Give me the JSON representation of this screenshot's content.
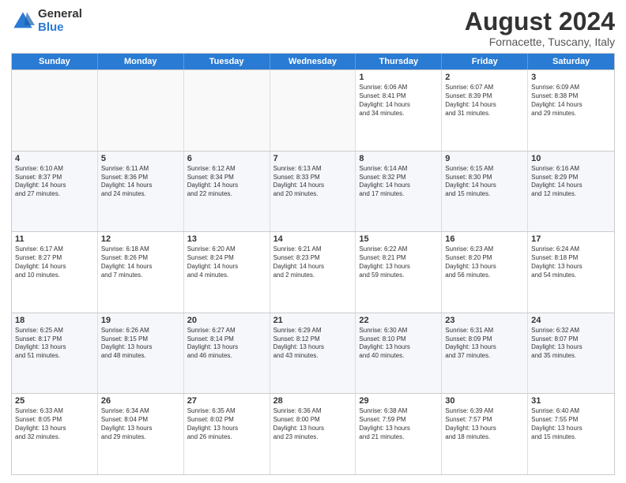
{
  "header": {
    "logo_general": "General",
    "logo_blue": "Blue",
    "title": "August 2024",
    "subtitle": "Fornacette, Tuscany, Italy"
  },
  "days_of_week": [
    "Sunday",
    "Monday",
    "Tuesday",
    "Wednesday",
    "Thursday",
    "Friday",
    "Saturday"
  ],
  "weeks": [
    [
      {
        "day": "",
        "info": ""
      },
      {
        "day": "",
        "info": ""
      },
      {
        "day": "",
        "info": ""
      },
      {
        "day": "",
        "info": ""
      },
      {
        "day": "1",
        "info": "Sunrise: 6:06 AM\nSunset: 8:41 PM\nDaylight: 14 hours\nand 34 minutes."
      },
      {
        "day": "2",
        "info": "Sunrise: 6:07 AM\nSunset: 8:39 PM\nDaylight: 14 hours\nand 31 minutes."
      },
      {
        "day": "3",
        "info": "Sunrise: 6:09 AM\nSunset: 8:38 PM\nDaylight: 14 hours\nand 29 minutes."
      }
    ],
    [
      {
        "day": "4",
        "info": "Sunrise: 6:10 AM\nSunset: 8:37 PM\nDaylight: 14 hours\nand 27 minutes."
      },
      {
        "day": "5",
        "info": "Sunrise: 6:11 AM\nSunset: 8:36 PM\nDaylight: 14 hours\nand 24 minutes."
      },
      {
        "day": "6",
        "info": "Sunrise: 6:12 AM\nSunset: 8:34 PM\nDaylight: 14 hours\nand 22 minutes."
      },
      {
        "day": "7",
        "info": "Sunrise: 6:13 AM\nSunset: 8:33 PM\nDaylight: 14 hours\nand 20 minutes."
      },
      {
        "day": "8",
        "info": "Sunrise: 6:14 AM\nSunset: 8:32 PM\nDaylight: 14 hours\nand 17 minutes."
      },
      {
        "day": "9",
        "info": "Sunrise: 6:15 AM\nSunset: 8:30 PM\nDaylight: 14 hours\nand 15 minutes."
      },
      {
        "day": "10",
        "info": "Sunrise: 6:16 AM\nSunset: 8:29 PM\nDaylight: 14 hours\nand 12 minutes."
      }
    ],
    [
      {
        "day": "11",
        "info": "Sunrise: 6:17 AM\nSunset: 8:27 PM\nDaylight: 14 hours\nand 10 minutes."
      },
      {
        "day": "12",
        "info": "Sunrise: 6:18 AM\nSunset: 8:26 PM\nDaylight: 14 hours\nand 7 minutes."
      },
      {
        "day": "13",
        "info": "Sunrise: 6:20 AM\nSunset: 8:24 PM\nDaylight: 14 hours\nand 4 minutes."
      },
      {
        "day": "14",
        "info": "Sunrise: 6:21 AM\nSunset: 8:23 PM\nDaylight: 14 hours\nand 2 minutes."
      },
      {
        "day": "15",
        "info": "Sunrise: 6:22 AM\nSunset: 8:21 PM\nDaylight: 13 hours\nand 59 minutes."
      },
      {
        "day": "16",
        "info": "Sunrise: 6:23 AM\nSunset: 8:20 PM\nDaylight: 13 hours\nand 56 minutes."
      },
      {
        "day": "17",
        "info": "Sunrise: 6:24 AM\nSunset: 8:18 PM\nDaylight: 13 hours\nand 54 minutes."
      }
    ],
    [
      {
        "day": "18",
        "info": "Sunrise: 6:25 AM\nSunset: 8:17 PM\nDaylight: 13 hours\nand 51 minutes."
      },
      {
        "day": "19",
        "info": "Sunrise: 6:26 AM\nSunset: 8:15 PM\nDaylight: 13 hours\nand 48 minutes."
      },
      {
        "day": "20",
        "info": "Sunrise: 6:27 AM\nSunset: 8:14 PM\nDaylight: 13 hours\nand 46 minutes."
      },
      {
        "day": "21",
        "info": "Sunrise: 6:29 AM\nSunset: 8:12 PM\nDaylight: 13 hours\nand 43 minutes."
      },
      {
        "day": "22",
        "info": "Sunrise: 6:30 AM\nSunset: 8:10 PM\nDaylight: 13 hours\nand 40 minutes."
      },
      {
        "day": "23",
        "info": "Sunrise: 6:31 AM\nSunset: 8:09 PM\nDaylight: 13 hours\nand 37 minutes."
      },
      {
        "day": "24",
        "info": "Sunrise: 6:32 AM\nSunset: 8:07 PM\nDaylight: 13 hours\nand 35 minutes."
      }
    ],
    [
      {
        "day": "25",
        "info": "Sunrise: 6:33 AM\nSunset: 8:05 PM\nDaylight: 13 hours\nand 32 minutes."
      },
      {
        "day": "26",
        "info": "Sunrise: 6:34 AM\nSunset: 8:04 PM\nDaylight: 13 hours\nand 29 minutes."
      },
      {
        "day": "27",
        "info": "Sunrise: 6:35 AM\nSunset: 8:02 PM\nDaylight: 13 hours\nand 26 minutes."
      },
      {
        "day": "28",
        "info": "Sunrise: 6:36 AM\nSunset: 8:00 PM\nDaylight: 13 hours\nand 23 minutes."
      },
      {
        "day": "29",
        "info": "Sunrise: 6:38 AM\nSunset: 7:59 PM\nDaylight: 13 hours\nand 21 minutes."
      },
      {
        "day": "30",
        "info": "Sunrise: 6:39 AM\nSunset: 7:57 PM\nDaylight: 13 hours\nand 18 minutes."
      },
      {
        "day": "31",
        "info": "Sunrise: 6:40 AM\nSunset: 7:55 PM\nDaylight: 13 hours\nand 15 minutes."
      }
    ]
  ]
}
